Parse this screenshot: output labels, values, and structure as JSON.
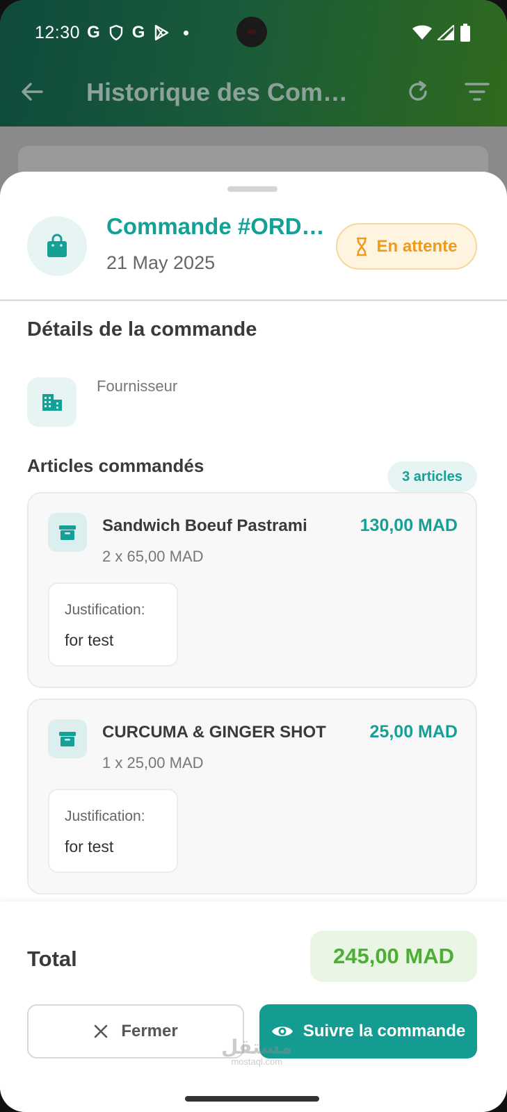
{
  "status_bar": {
    "time": "12:30",
    "notif_icons": [
      "g-icon",
      "shield-icon",
      "g-icon",
      "play-store-icon",
      "dot-icon"
    ]
  },
  "app_bar": {
    "title": "Historique des Com…"
  },
  "order": {
    "title": "Commande #ORD…",
    "date": "21 May 2025",
    "status": "En attente",
    "status_color": "#ee9a1a"
  },
  "details": {
    "section_title": "Détails de la commande",
    "supplier_label": "Fournisseur"
  },
  "articles": {
    "title": "Articles commandés",
    "count_label": "3 articles",
    "items": [
      {
        "name": "Sandwich Boeuf Pastrami",
        "qty_line": "2 x 65,00 MAD",
        "price": "130,00 MAD",
        "justification_label": "Justification:",
        "justification": "for test"
      },
      {
        "name": "CURCUMA & GINGER SHOT",
        "qty_line": "1 x 25,00 MAD",
        "price": "25,00 MAD",
        "justification_label": "Justification:",
        "justification": "for test"
      }
    ]
  },
  "footer": {
    "total_label": "Total",
    "total_value": "245,00 MAD",
    "close_label": "Fermer",
    "follow_label": "Suivre la commande"
  },
  "watermark": {
    "arabic": "مستقل",
    "latin": "mostaql.com"
  },
  "colors": {
    "accent": "#15a096",
    "pending": "#ee9a1a",
    "total": "#4caf35"
  }
}
